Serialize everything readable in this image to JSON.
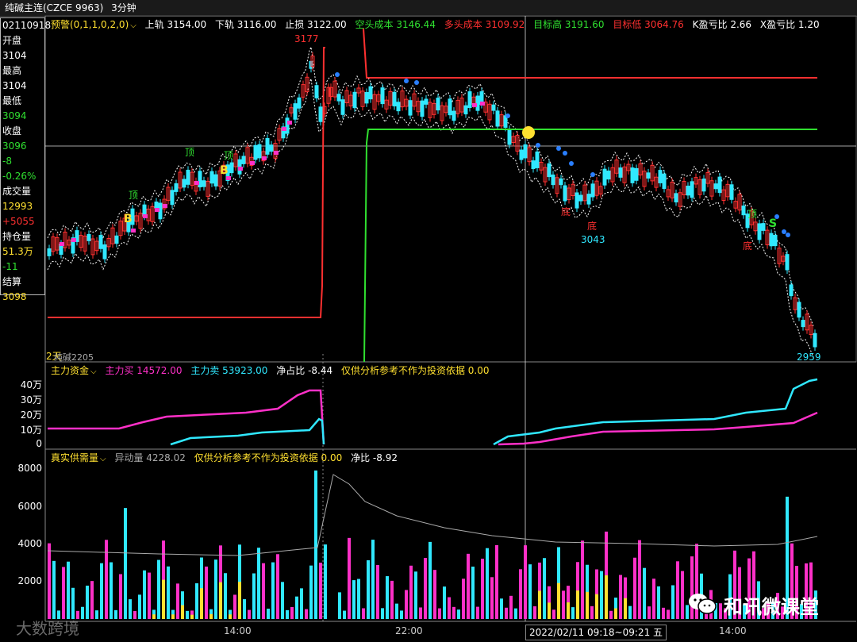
{
  "topbar": {
    "title": "纯碱主连(CZCE 9963)",
    "period": "3分钟"
  },
  "sidepanel": {
    "items": [
      {
        "label": "02110918",
        "value": ""
      },
      {
        "label": "开盘",
        "value": "3104"
      },
      {
        "label": "最高",
        "value": "3104"
      },
      {
        "label": "最低",
        "value": "3094"
      },
      {
        "label": "收盘",
        "value": "3096"
      },
      {
        "label": "-8",
        "value": "-0.26%"
      },
      {
        "label": "成交量",
        "value": "12993"
      },
      {
        "label": "+5055",
        "value": ""
      },
      {
        "label": "持仓量",
        "value": "51.3万"
      },
      {
        "label": "-11",
        "value": ""
      },
      {
        "label": "结算",
        "value": "3098"
      }
    ]
  },
  "main_legend": {
    "indicator": "预警(0,1,1,0,2,0)",
    "upper": "上轨 3154.00",
    "lower": "下轨 3116.00",
    "stop": "止损 3122.00",
    "short_cost": "空头成本 3146.44",
    "long_cost": "多头成本 3109.92",
    "target_high": "目标高 3191.60",
    "target_low": "目标低 3064.76",
    "k_ratio": "K盈亏比 2.66",
    "x_ratio": "X盈亏比 1.20"
  },
  "main_annotations": {
    "high": "3177",
    "mid_low": "3043",
    "low": "2959",
    "contract": "2天",
    "contract_code": "纯碱2205",
    "top_label": "顶",
    "bottom_label": "底",
    "buy": "B",
    "sell": "S"
  },
  "fund_legend": {
    "name": "主力资金",
    "buy": "主力买 14572.00",
    "sell": "主力卖 53923.00",
    "net": "净占比 -8.44",
    "note": "仅供分析参考不作为投资依据 0.00"
  },
  "fund_axis": [
    "40万",
    "30万",
    "20万",
    "10万",
    "0"
  ],
  "volume_legend": {
    "name": "真实供需量",
    "abnormal": "异动量 4228.02",
    "note": "仅供分析参考不作为投资依据 0.00",
    "net": "净比 -8.92"
  },
  "volume_axis": [
    "8000",
    "6000",
    "4000",
    "2000"
  ],
  "xaxis": [
    "14:00",
    "22:00",
    "14:00"
  ],
  "crosshair_time": "2022/02/11 09:18~09:21 五",
  "watermark": "和讯微课堂",
  "watermark2": "大数跨境",
  "colors": {
    "up": "#ff3030",
    "down": "#30e8ff",
    "magenta": "#ff30c8",
    "green": "#30e030",
    "yellow": "#ffe030"
  }
}
